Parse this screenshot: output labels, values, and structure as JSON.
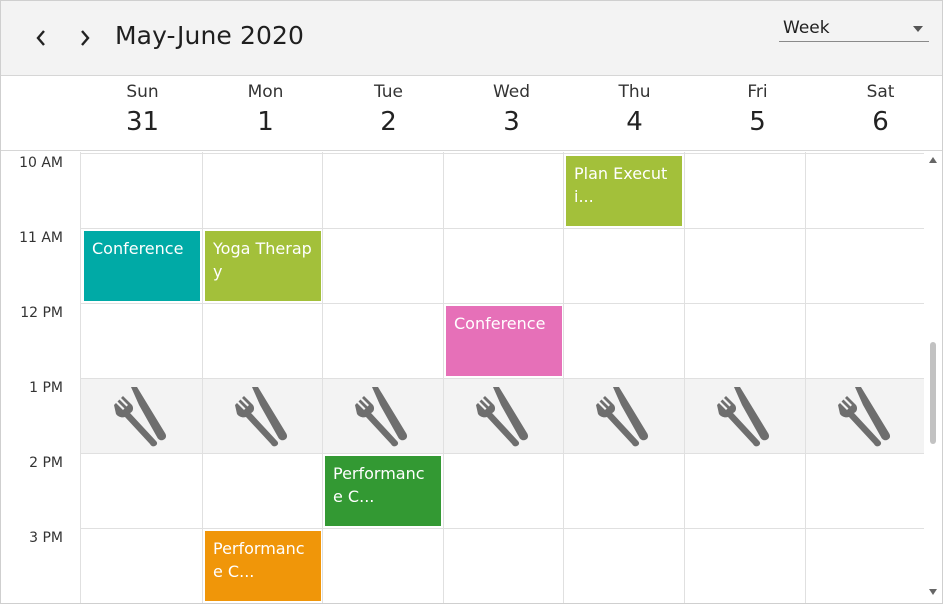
{
  "header": {
    "title": "May-June 2020",
    "prev_icon": "chevron-left-icon",
    "next_icon": "chevron-right-icon",
    "view_selected": "Week"
  },
  "days": [
    {
      "name": "Sun",
      "date": "31"
    },
    {
      "name": "Mon",
      "date": "1"
    },
    {
      "name": "Tue",
      "date": "2"
    },
    {
      "name": "Wed",
      "date": "3"
    },
    {
      "name": "Thu",
      "date": "4"
    },
    {
      "name": "Fri",
      "date": "5"
    },
    {
      "name": "Sat",
      "date": "6"
    }
  ],
  "times": [
    "10 AM",
    "11 AM",
    "12 PM",
    "1 PM",
    "2 PM",
    "3 PM"
  ],
  "lunch_icon": "fork-knife-icon",
  "appointments": [
    {
      "subject": "Plan Executi...",
      "day": "Thu",
      "start": "10 AM",
      "color": "#a3c03a"
    },
    {
      "subject": "Conference",
      "day": "Sun",
      "start": "11 AM",
      "color": "#00aaa6"
    },
    {
      "subject": "Yoga Therapy",
      "day": "Mon",
      "start": "11 AM",
      "color": "#a3c03a"
    },
    {
      "subject": "Conference",
      "day": "Wed",
      "start": "12 PM",
      "color": "#e670b8"
    },
    {
      "subject": "Performance C...",
      "day": "Tue",
      "start": "2 PM",
      "color": "#339933"
    },
    {
      "subject": "Performance C...",
      "day": "Mon",
      "start": "3 PM",
      "color": "#f09609"
    }
  ],
  "colors": {
    "header_bg": "#f3f3f3",
    "lunch_bg": "#f3f3f3",
    "grid_line": "#e0e0e0",
    "scrollbar_thumb": "#c2c2c2"
  }
}
